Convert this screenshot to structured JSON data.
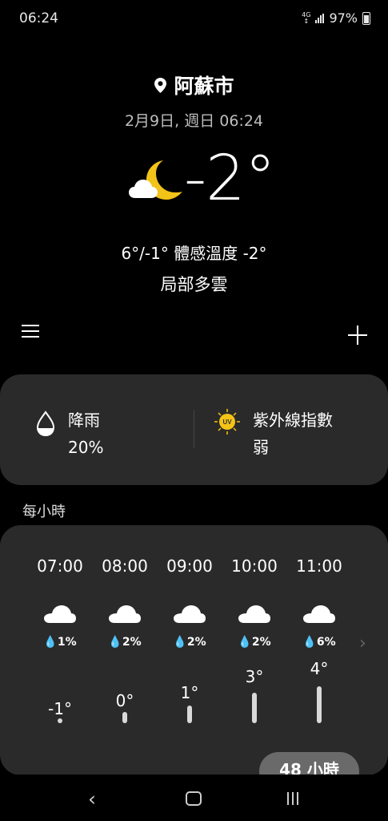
{
  "status_bar": {
    "time": "06:24",
    "network": "4G",
    "battery": "97%"
  },
  "location": {
    "city": "阿蘇市"
  },
  "date": "2月9日, 週日 06:24",
  "current": {
    "temperature": "-2°",
    "range": "6°/-1°",
    "feels_like": "體感溫度 -2°",
    "condition": "局部多雲"
  },
  "card": {
    "rain_label": "降雨",
    "rain_value": "20%",
    "uv_label": "紫外線指數",
    "uv_value": "弱"
  },
  "hourly_title": "每小時",
  "hourly": [
    {
      "time": "07:00",
      "precip": "1%",
      "temp": "-1°",
      "value": -1
    },
    {
      "time": "08:00",
      "precip": "2%",
      "temp": "0°",
      "value": 0
    },
    {
      "time": "09:00",
      "precip": "2%",
      "temp": "1°",
      "value": 1
    },
    {
      "time": "10:00",
      "precip": "2%",
      "temp": "3°",
      "value": 3
    },
    {
      "time": "11:00",
      "precip": "6%",
      "temp": "4°",
      "value": 4
    }
  ],
  "button_48h": "48 小時"
}
